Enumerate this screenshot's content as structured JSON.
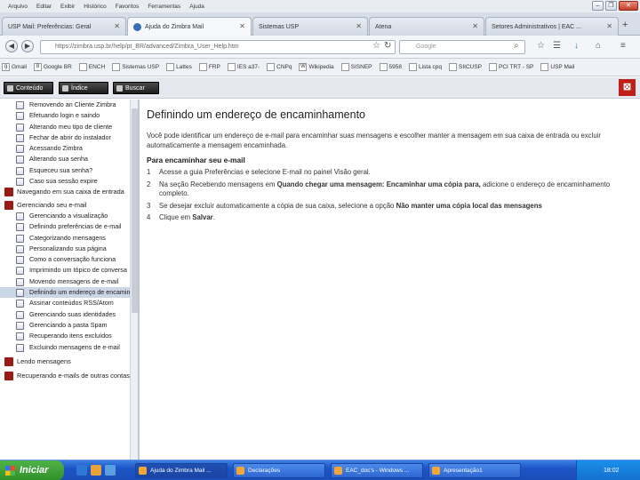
{
  "menu": [
    "Arquivo",
    "Editar",
    "Exibir",
    "Histórico",
    "Favoritos",
    "Ferramentas",
    "Ajuda"
  ],
  "window_controls": {
    "minimize": "–",
    "restore": "❐",
    "close": "✕"
  },
  "tabs": [
    {
      "label": "USP Mail: Preferências: Geral"
    },
    {
      "label": "Ajuda do Zimbra Mail"
    },
    {
      "label": "Sistemas USP"
    },
    {
      "label": "Atena"
    },
    {
      "label": "Setores Administrativos | EAC ..."
    }
  ],
  "nav": {
    "url": "https://zimbra.usp.br/help/pt_BR/advanced/Zimbra_User_Help.htm",
    "search_placeholder": "Google"
  },
  "bookmarks": [
    "Gmail",
    "Google BR",
    "ENCH",
    "Sistemas USP",
    "Lattes",
    "FRP",
    "IES a37-",
    "CNPq",
    "Wikipedia",
    "SISNEP",
    "5958",
    "Lista cpq",
    "SIICUSP",
    "PCI TRT - SP",
    "USP Mail"
  ],
  "app_toolbar": {
    "conteudo": "Conteúdo",
    "indice": "Índice",
    "buscar": "Buscar"
  },
  "sidebar": {
    "items_top": [
      "Removendo an Cliente Zimbra",
      "Efetuando login e saindo",
      "Alterando meu tipo de cliente",
      "Fechar de abrir do instalador",
      "Acessando Zimbra",
      "Alterando sua senha",
      "Esqueceu sua senha?",
      "Caso sua sessão expire"
    ],
    "group_1": "Navegando em sua caixa de entrada",
    "group_2": "Gerenciando seu e-mail",
    "items_mail": [
      "Gerenciando a visualização",
      "Definindo preferências de e-mail",
      "Categorizando mensagens",
      "Personalizando sua página",
      "Como a conversação funciona",
      "Imprimindo um tópico de conversa",
      "Movendo mensagens de e-mail",
      "Definindo um endereço de encaminhamento",
      "Assinar conteúdos RSS/Atom",
      "Gerenciando suas identidades",
      "Gerenciando a pasta Spam",
      "Recuperando itens excluídos",
      "Excluindo mensagens de e-mail"
    ],
    "group_3": "Lendo mensagens",
    "group_4": "Recuperando e-mails de outras contas"
  },
  "content": {
    "title": "Definindo um endereço de encaminhamento",
    "intro": "Você pode identificar um endereço de e-mail para encaminhar suas mensagens e escolher manter a mensagem em sua caixa de entrada ou excluir automaticamente a mensagem encaminhada.",
    "subtitle": "Para encaminhar seu e-mail",
    "steps": [
      {
        "n": "1",
        "pre": "Acesse a guia Preferências e selecione E-mail no painel Visão geral.",
        "bold": "",
        "post": ""
      },
      {
        "n": "2",
        "pre": "Na seção Recebendo mensagens em ",
        "bold": "Quando chegar uma mensagem: Encaminhar uma cópia para,",
        "post": " adicione o endereço de encaminhamento completo."
      },
      {
        "n": "3",
        "pre": "Se desejar excluir automaticamente a cópia de sua caixa, selecione a opção ",
        "bold": "",
        "post": "Não manter uma cópia local das mensagens"
      },
      {
        "n": "4",
        "pre": "Clique em ",
        "bold": "Salvar",
        "post": "."
      }
    ]
  },
  "taskbar": {
    "start": "Iniciar",
    "tasks": [
      "Ajuda do Zimbra Mail ...",
      "Declarações",
      "EAC_doc's - Windows ...",
      "Apresentação1"
    ],
    "clock": "18:02"
  },
  "colors": {
    "sidebar_selected": "#cbd6e6",
    "taskbar": "#1d55c7",
    "start": "#2e8f28",
    "brand_red": "#c0201a"
  }
}
